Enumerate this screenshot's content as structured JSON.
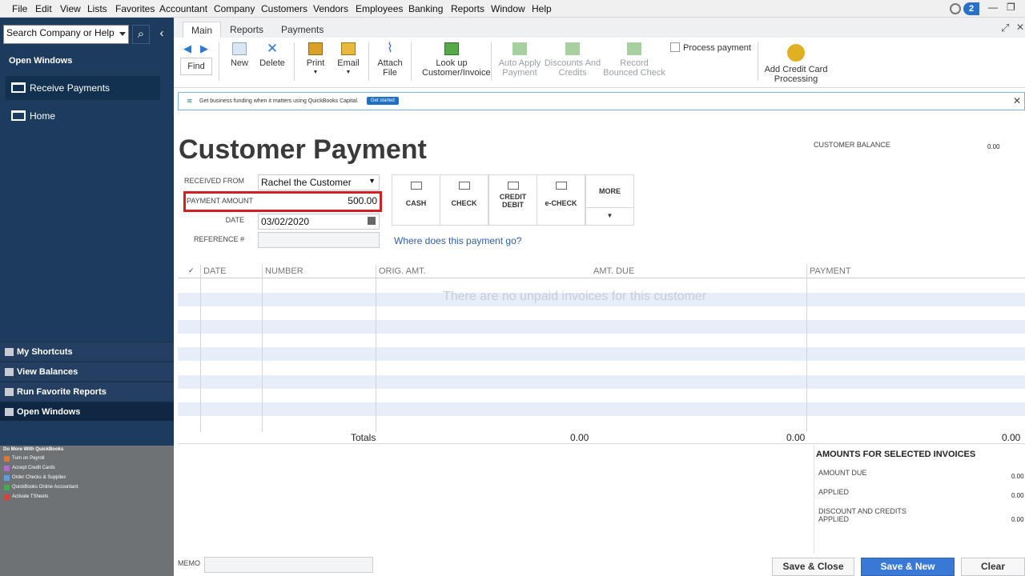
{
  "menu": [
    "File",
    "Edit",
    "View",
    "Lists",
    "Favorites",
    "Accountant",
    "Company",
    "Customers",
    "Vendors",
    "Employees",
    "Banking",
    "Reports",
    "Window",
    "Help"
  ],
  "notification_count": "2",
  "sidebar": {
    "search_placeholder": "Search Company or Help",
    "open_windows_heading": "Open Windows",
    "windows": [
      "Receive Payments",
      "Home"
    ],
    "nav": [
      "My Shortcuts",
      "View Balances",
      "Run Favorite Reports",
      "Open Windows"
    ],
    "do_more_heading": "Do More With QuickBooks",
    "do_more_items": [
      "Turn on Payroll",
      "Accept Credit Cards",
      "Order Checks & Supplies",
      "QuickBooks Online Accountant",
      "Activate TSheets"
    ]
  },
  "tabs": [
    "Main",
    "Reports",
    "Payments"
  ],
  "toolbar": {
    "find": "Find",
    "new": "New",
    "delete": "Delete",
    "print": "Print",
    "email": "Email",
    "attach_file": "Attach File",
    "lookup": "Look up Customer/Invoice",
    "auto_apply": "Auto Apply Payment",
    "discounts": "Discounts And Credits",
    "record_bounced": "Record Bounced Check",
    "process_payment": "Process payment",
    "add_cc": "Add Credit Card Processing"
  },
  "banner": {
    "text": "Get business funding when it matters using QuickBooks Capital.",
    "cta": "Get started"
  },
  "form": {
    "title": "Customer Payment",
    "customer_balance_label": "CUSTOMER BALANCE",
    "customer_balance_value": "0.00",
    "received_from_label": "RECEIVED FROM",
    "received_from_value": "Rachel the Customer",
    "payment_amount_label": "PAYMENT AMOUNT",
    "payment_amount_value": "500.00",
    "date_label": "DATE",
    "date_value": "03/02/2020",
    "reference_label": "REFERENCE #",
    "reference_value": "",
    "methods": [
      "CASH",
      "CHECK",
      "CREDIT DEBIT",
      "e-CHECK"
    ],
    "more": "MORE",
    "where_link": "Where does this payment go?"
  },
  "table": {
    "columns": [
      "✓",
      "DATE",
      "NUMBER",
      "ORIG. AMT.",
      "AMT. DUE",
      "PAYMENT"
    ],
    "empty_message": "There are no unpaid invoices for this customer",
    "totals_label": "Totals",
    "totals": [
      "0.00",
      "0.00",
      "0.00"
    ]
  },
  "selected": {
    "heading": "AMOUNTS FOR SELECTED INVOICES",
    "amount_due_label": "AMOUNT DUE",
    "amount_due": "0.00",
    "applied_label": "APPLIED",
    "applied": "0.00",
    "discount_label": "DISCOUNT AND CREDITS APPLIED",
    "discount": "0.00"
  },
  "memo_label": "MEMO",
  "buttons": {
    "save_close": "Save & Close",
    "save_new": "Save & New",
    "clear": "Clear"
  }
}
